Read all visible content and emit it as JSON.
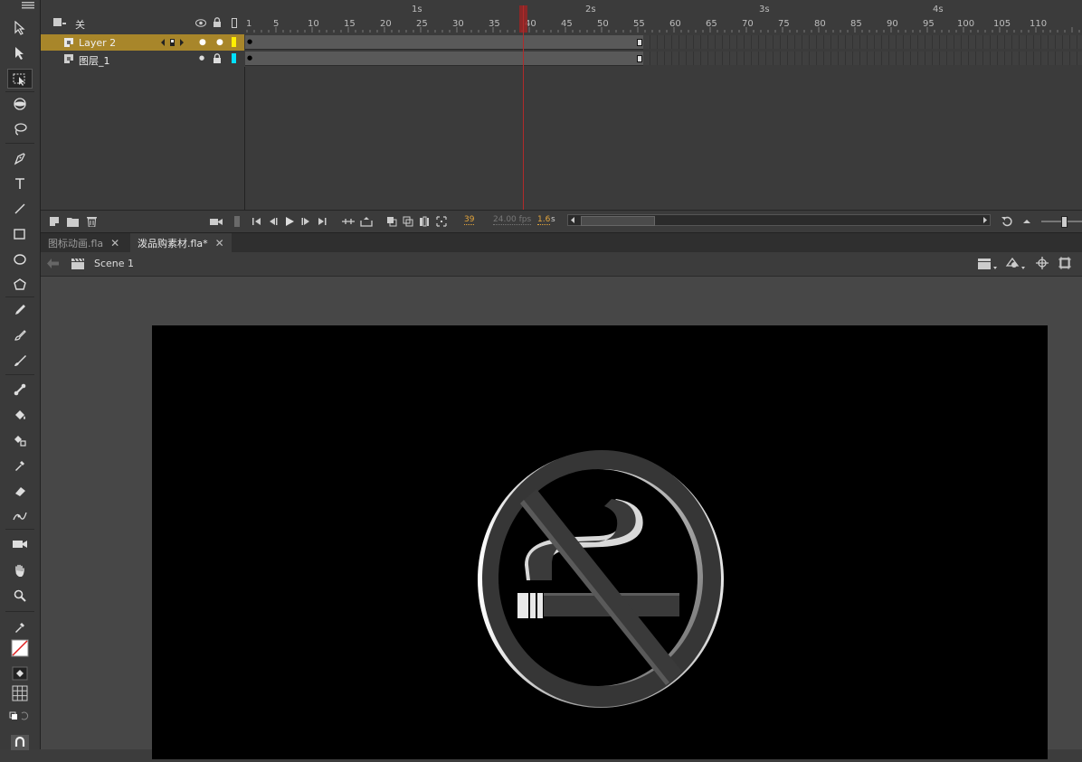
{
  "timeline": {
    "header_label": "关",
    "layers": [
      {
        "name": "Layer 2",
        "selected": true,
        "color": "#ffee00"
      },
      {
        "name": "图层_1",
        "selected": false,
        "color": "#00e0ff"
      }
    ],
    "frame_ticks": [
      "1",
      "5",
      "10",
      "15",
      "20",
      "25",
      "30",
      "35",
      "40",
      "45",
      "50",
      "55",
      "60",
      "65",
      "70",
      "75",
      "80",
      "85",
      "90",
      "95",
      "100",
      "105",
      "110"
    ],
    "seconds": [
      "1s",
      "2s",
      "3s",
      "4s"
    ],
    "current_frame": "39",
    "fps": "24.00 fps",
    "elapsed": "1.6",
    "elapsed_unit": "s"
  },
  "tabs": [
    {
      "label": "图标动画.fla",
      "active": false
    },
    {
      "label": "泼品购素材.fla*",
      "active": true
    }
  ],
  "scene": {
    "label": "Scene 1"
  },
  "colors": {
    "playhead": "#b12b2b",
    "selected_layer": "#a8862a",
    "accent_number": "#e3a53c"
  },
  "icons": [
    "selection-tool",
    "subselection-tool",
    "free-transform-tool",
    "3d-rotation-tool",
    "lasso-tool",
    "pen-tool",
    "text-tool",
    "line-tool",
    "rectangle-tool",
    "oval-tool",
    "polystar-tool",
    "pencil-tool",
    "paint-brush-tool",
    "brush-tool",
    "bone-tool",
    "paint-bucket-tool",
    "ink-bottle-tool",
    "eyedropper-tool",
    "eraser-tool",
    "width-tool",
    "camera-tool",
    "hand-tool",
    "zoom-tool"
  ]
}
